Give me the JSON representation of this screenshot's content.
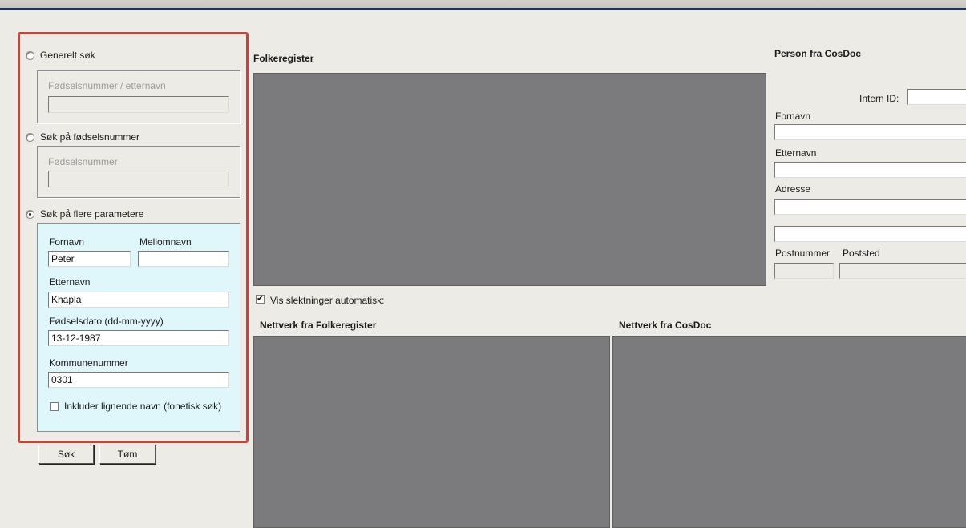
{
  "search": {
    "general_label": "Generelt søk",
    "general_placeholder": "Fødselsnummer / etternavn",
    "general_value": "",
    "fnr_label": "Søk på fødselsnummer",
    "fnr_placeholder": "Fødselsnummer",
    "fnr_value": "",
    "multi_label": "Søk på flere parametere",
    "selected": "multi",
    "firstname_label": "Fornavn",
    "firstname_value": "Peter",
    "middlename_label": "Mellomnavn",
    "middlename_value": "",
    "lastname_label": "Etternavn",
    "lastname_value": "Khapla",
    "birthdate_label": "Fødselsdato (dd-mm-yyyy)",
    "birthdate_value": "13-12-1987",
    "municipality_label": "Kommunenummer",
    "municipality_value": "0301",
    "phonetic_label": "Inkluder lignende navn (fonetisk søk)",
    "phonetic_checked": false,
    "search_button": "Søk",
    "clear_button": "Tøm"
  },
  "folkeregister": {
    "title": "Folkeregister",
    "show_relatives_label": "Vis slektninger automatisk:",
    "show_relatives_checked": true
  },
  "network": {
    "folkeregister_title": "Nettverk fra Folkeregister",
    "cosdoc_title": "Nettverk fra CosDoc"
  },
  "person": {
    "title": "Person fra CosDoc",
    "intern_id_label": "Intern ID:",
    "intern_id_value": "",
    "firstname_label": "Fornavn",
    "firstname_value": "",
    "lastname_label": "Etternavn",
    "lastname_value": "",
    "address_label": "Adresse",
    "address_line1": "",
    "address_line2": "",
    "postnumber_label": "Postnummer",
    "postnumber_value": "",
    "poststed_label": "Poststed",
    "poststed_value": ""
  },
  "colors": {
    "highlight_border": "#c0473e",
    "panel_gray": "#7b7a7c",
    "params_background": "#dff6fb",
    "window_background": "#ecebe6"
  }
}
